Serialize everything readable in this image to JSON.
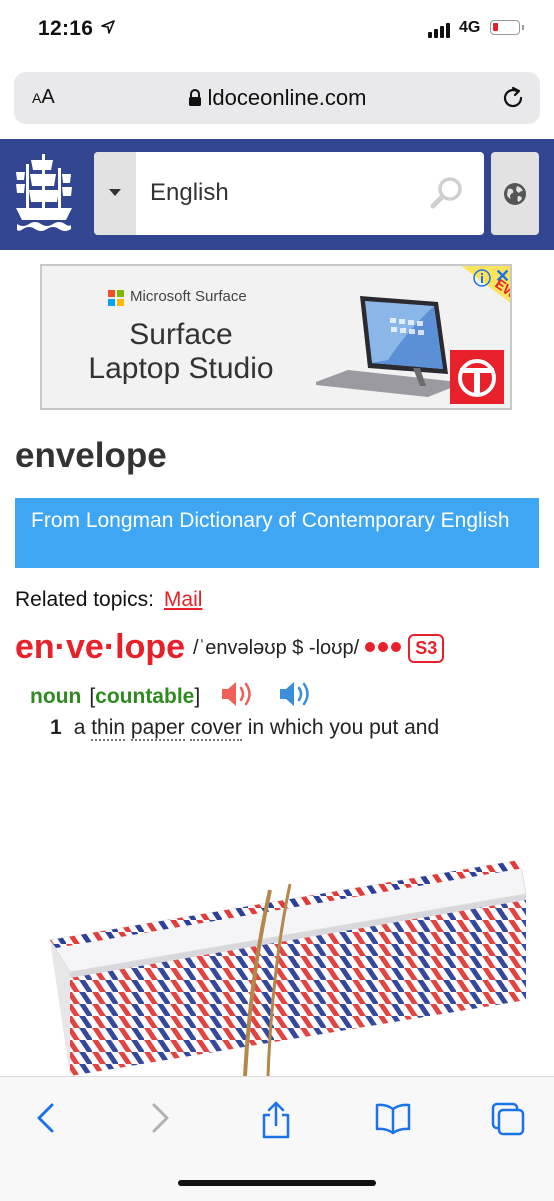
{
  "status_bar": {
    "time": "12:16",
    "network": "4G"
  },
  "url_bar": {
    "aa_small": "A",
    "aa_big": "A",
    "domain": "ldoceonline.com"
  },
  "search": {
    "language": "English"
  },
  "ad": {
    "brand": "Microsoft Surface",
    "title_line1": "Surface",
    "title_line2": "Laptop Studio",
    "corner_tag": "EW",
    "close": "✕"
  },
  "entry": {
    "headword": "envelope",
    "banner": "From Longman Dictionary of Contemporary English",
    "related_label": "Related topics:",
    "related_link": "Mail",
    "syllabified": "en·ve·lope",
    "pronunciation": "/ˈenvələʊp $ -loʊp/",
    "frequency_badge": "S3",
    "pos": "noun",
    "grammar_open": "[",
    "grammar": "countable",
    "grammar_close": "]",
    "sense_number": "1",
    "sense_a": "a",
    "sense_thin": "thin",
    "sense_paper": "paper",
    "sense_cover": "cover",
    "sense_rest": "in which you put and"
  },
  "colors": {
    "header_blue": "#314591",
    "banner_blue": "#3ea6f2",
    "longman_red": "#e8202a",
    "pos_green": "#2e8b1e",
    "ios_blue": "#1a73e8"
  },
  "toolbar": {
    "icons": [
      "back-icon",
      "forward-icon",
      "share-icon",
      "bookmarks-icon",
      "tabs-icon"
    ]
  }
}
